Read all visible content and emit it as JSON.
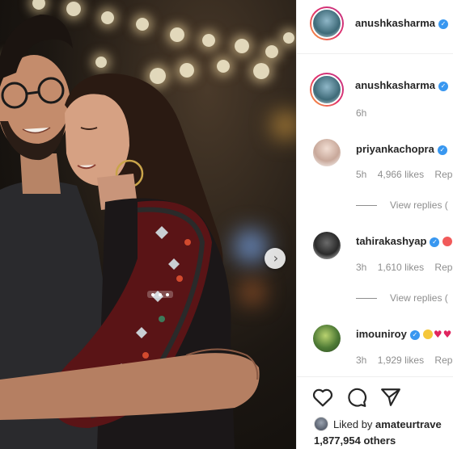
{
  "post_header": {
    "username": "anushkasharma",
    "verified": true
  },
  "caption": {
    "username": "anushkasharma",
    "verified": true,
    "time": "6h"
  },
  "comments": [
    {
      "username": "priyankachopra",
      "verified": true,
      "time": "5h",
      "likes": "4,966 likes",
      "reply": "Rep",
      "view_replies": "View replies ("
    },
    {
      "username": "tahirakashyap",
      "verified": true,
      "time": "3h",
      "likes": "1,610 likes",
      "reply": "Rep",
      "view_replies": "View replies ("
    },
    {
      "username": "imouniroy",
      "verified": true,
      "time": "3h",
      "likes": "1,929 likes",
      "reply": "Rep"
    }
  ],
  "actions": {
    "like_icon": "heart-outline-icon",
    "comment_icon": "comment-bubble-icon",
    "share_icon": "paper-plane-icon"
  },
  "liked_by": {
    "prefix": "Liked by",
    "user": "amateurtrave",
    "count": "1,877,954 others"
  },
  "colors": {
    "verified": "#3897f0",
    "secondary_text": "#8e8e8e",
    "primary_text": "#262626"
  }
}
